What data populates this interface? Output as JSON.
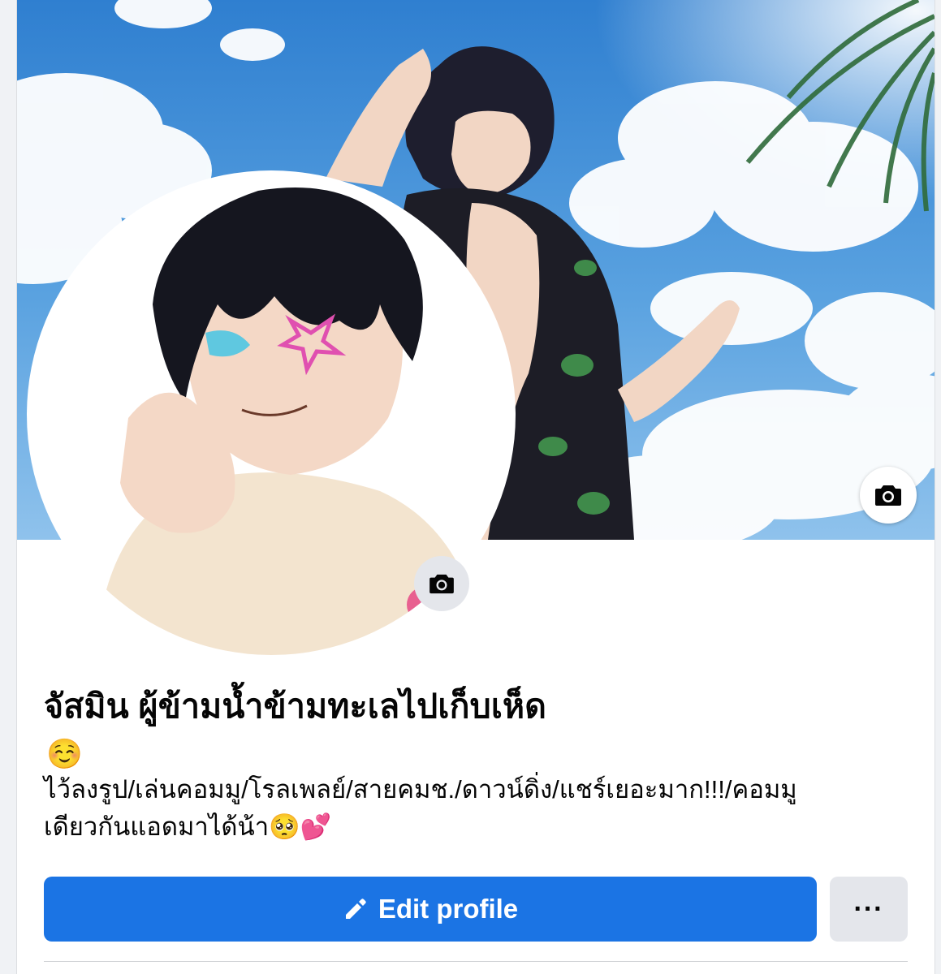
{
  "profile": {
    "name": "จัสมิน ผู้ข้ามน้ำข้ามทะเลไปเก็บเห็ด",
    "emoji": "☺️",
    "bio_line_1": "ไว้ลงรูป/เล่นคอมมู/โรลเพลย์/สายคมช./ดาวน์ดิ่ง/แชร์เยอะมาก!!!/คอมมู",
    "bio_line_2": "เดียวกันแอดมาได้น้า🥺💕"
  },
  "actions": {
    "edit_profile_label": "Edit profile",
    "more_label": "···"
  },
  "icons": {
    "cover_camera": "camera-icon",
    "avatar_camera": "camera-icon",
    "edit": "pencil-icon"
  },
  "colors": {
    "primary": "#1b74e4",
    "secondary_button": "#e4e6eb",
    "sky": "#4a8fd4"
  }
}
